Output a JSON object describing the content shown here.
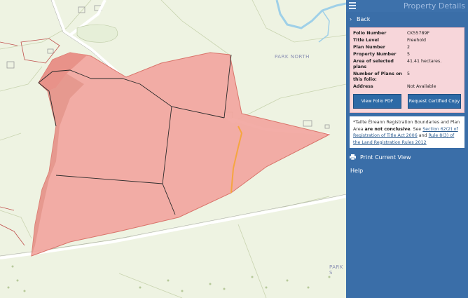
{
  "map": {
    "labels": {
      "park_north": "PARK NORTH",
      "park_s": "PARK S"
    },
    "colors": {
      "background": "#eef3e2",
      "parcel_fill": "#f2a69f",
      "parcel_edge": "#c0504d",
      "road": "#ffffff",
      "river": "#9fd0e8",
      "track": "#f5a640"
    }
  },
  "panel": {
    "title": "Property Details",
    "back_label": "Back",
    "details": [
      {
        "key": "Folio Number",
        "value": "CK55789F"
      },
      {
        "key": "Title Level",
        "value": "Freehold"
      },
      {
        "key": "Plan Number",
        "value": "2"
      },
      {
        "key": "Property Number",
        "value": "5"
      },
      {
        "key": "Area of selected plans",
        "value": "41.41 hectares."
      },
      {
        "key": "Number of Plans on this folio:",
        "value": "5"
      },
      {
        "key": "Address",
        "value": "Not Available"
      }
    ],
    "buttons": {
      "view_pdf": "View Folio PDF",
      "certified_copy": "Request Certified Copy"
    },
    "note": {
      "prefix": "*Tailte Éireann Registration Boundaries and Plan Area ",
      "bold": "are not conclusive",
      "middle": ". See ",
      "link1": "Section 62(2) of Registration of Title Act 2006",
      "and": " and ",
      "link2": "Rule 8(3) of the Land Registration Rules 2012"
    },
    "print_label": "Print Current View",
    "help_label": "Help",
    "colors": {
      "panel": "#3a6ea8",
      "details_bg": "#f7d6da",
      "button": "#2d6aa6"
    }
  }
}
